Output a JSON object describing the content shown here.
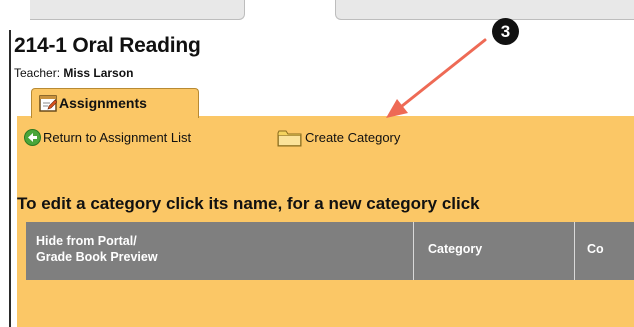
{
  "page": {
    "title": "214-1 Oral Reading",
    "teacher_label": "Teacher:",
    "teacher_name": "Miss Larson"
  },
  "tabs": [
    {
      "label": "Assignments",
      "icon": "notepad-icon",
      "active": true
    }
  ],
  "toolbar": {
    "return_label": "Return to Assignment List",
    "return_icon": "back-arrow-icon",
    "create_label": "Create Category",
    "create_icon": "folder-icon"
  },
  "instruction": "To edit a category click its name, for a new category click",
  "table": {
    "columns": [
      {
        "label_line1": "Hide from Portal/",
        "label_line2": "Grade Book Preview"
      },
      {
        "label": "Category"
      },
      {
        "label": "Co"
      }
    ]
  },
  "annotation": {
    "badge": "3",
    "arrow_color": "#ee6a55"
  },
  "colors": {
    "panel": "#fbc766",
    "header": "#7f7f7f",
    "back_icon": "#4aa63a",
    "folder_icon": "#f4d35e"
  }
}
